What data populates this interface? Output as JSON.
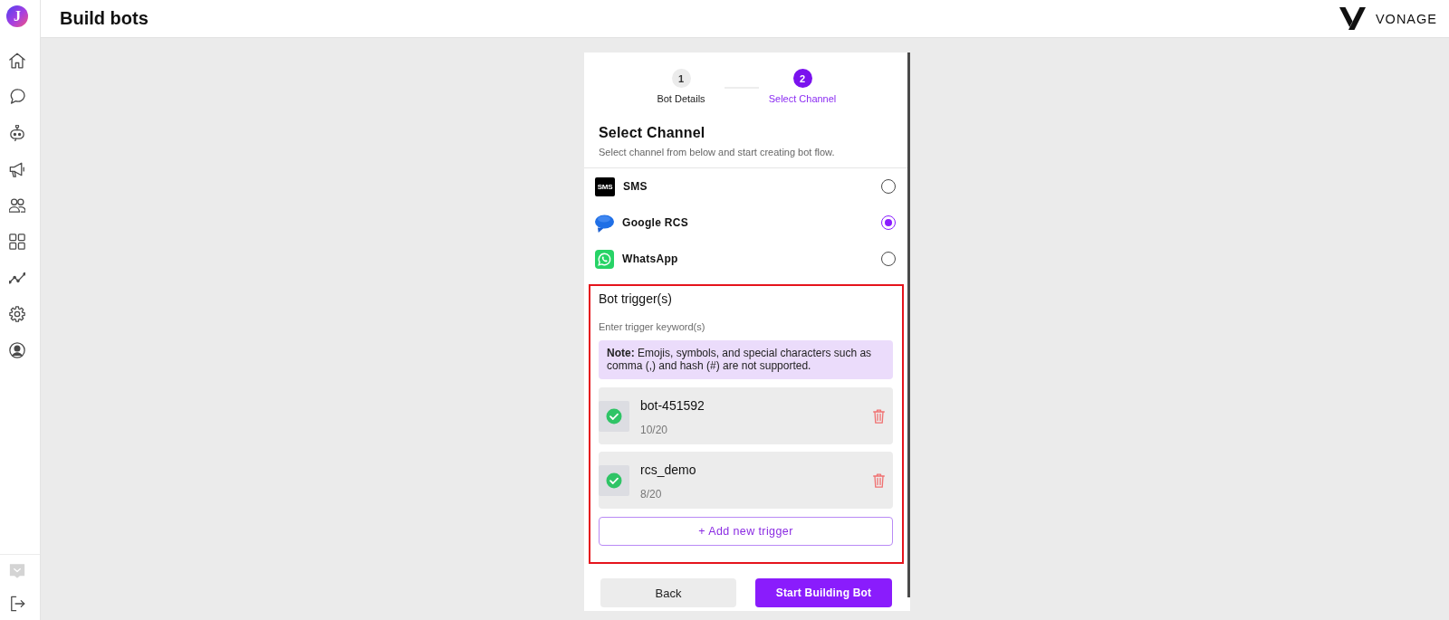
{
  "app": {
    "logo": "J",
    "title": "Build bots",
    "brand": "VONAGE"
  },
  "sidebar": {
    "items": [
      {
        "kind": "home"
      },
      {
        "kind": "chat"
      },
      {
        "kind": "bot"
      },
      {
        "kind": "megaphone"
      },
      {
        "kind": "people"
      },
      {
        "kind": "grid"
      },
      {
        "kind": "trend"
      },
      {
        "kind": "gear"
      },
      {
        "kind": "account"
      }
    ],
    "bottom_items": [
      {
        "kind": "inbox",
        "disabled": true
      },
      {
        "kind": "logout",
        "disabled": false
      }
    ]
  },
  "stepper": {
    "steps": [
      {
        "number": "1",
        "label": "Bot Details",
        "selected": false
      },
      {
        "number": "2",
        "label": "Select Channel",
        "selected": true
      }
    ]
  },
  "channel_section": {
    "title": "Select Channel",
    "subtitle": "Select channel from below and start creating bot flow.",
    "channels": [
      {
        "kind": "sms",
        "icon_text": "SMS",
        "name": "SMS",
        "selected": false
      },
      {
        "kind": "rcs",
        "name": "Google RCS",
        "selected": true
      },
      {
        "kind": "whatsapp",
        "name": "WhatsApp",
        "selected": false
      }
    ]
  },
  "trigger_section": {
    "highlighted": true,
    "title": "Bot trigger(s)",
    "hint": "Enter trigger keyword(s)",
    "note": "**Note:** Emojis, symbols, and special characters such as comma (,) and hash (#) are not supported.",
    "triggers": [
      {
        "keyword": "bot-451592",
        "count": "10/20",
        "valid": true
      },
      {
        "keyword": "rcs_demo",
        "count": "8/20",
        "valid": true
      }
    ],
    "add_button": "+ Add new trigger"
  },
  "actions": [
    {
      "kind": "secondary",
      "label": "Back"
    },
    {
      "kind": "primary",
      "label": "Start Building Bot"
    }
  ]
}
